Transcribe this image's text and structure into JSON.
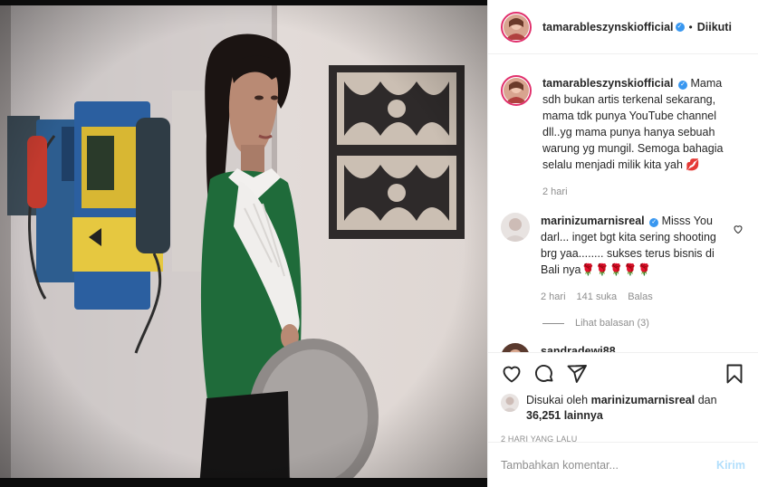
{
  "post": {
    "author": "tamarableszynskiofficial",
    "follow_label": "Diikuti",
    "caption": "Mama sdh bukan artis terkenal sekarang, mama tdk punya YouTube channel dll..yg mama punya hanya sebuah warung yg mungil. Semoga bahagia selalu menjadi milik kita yah ",
    "caption_emoji": "💋",
    "caption_time": "2 hari"
  },
  "comments": [
    {
      "user": "marinizumarnisreal",
      "text": "Misss You darl... inget bgt kita sering shooting brg yaa........ sukses terus bisnis di Bali nya",
      "emoji": "🌹🌹🌹🌹🌹",
      "time": "2 hari",
      "likes": "141 suka",
      "reply_label": "Balas",
      "view_replies": "Lihat balasan (3)"
    },
    {
      "user": "sandradewi88",
      "text": ""
    }
  ],
  "likes": {
    "prefix": "Disukai oleh",
    "user": "marinizumarnisreal",
    "connector": "dan",
    "count": "36,251 lainnya"
  },
  "timestamp": "2 HARI YANG LALU",
  "add_comment": {
    "placeholder": "Tambahkan komentar...",
    "post_label": "Kirim"
  },
  "icons": [
    "heart-icon",
    "comment-icon",
    "share-icon",
    "bookmark-icon",
    "verified-icon"
  ],
  "colors": {
    "verified": "#3897f0",
    "muted": "#8e8e8e",
    "post_button": "#b2dffc",
    "border": "#efefef"
  }
}
